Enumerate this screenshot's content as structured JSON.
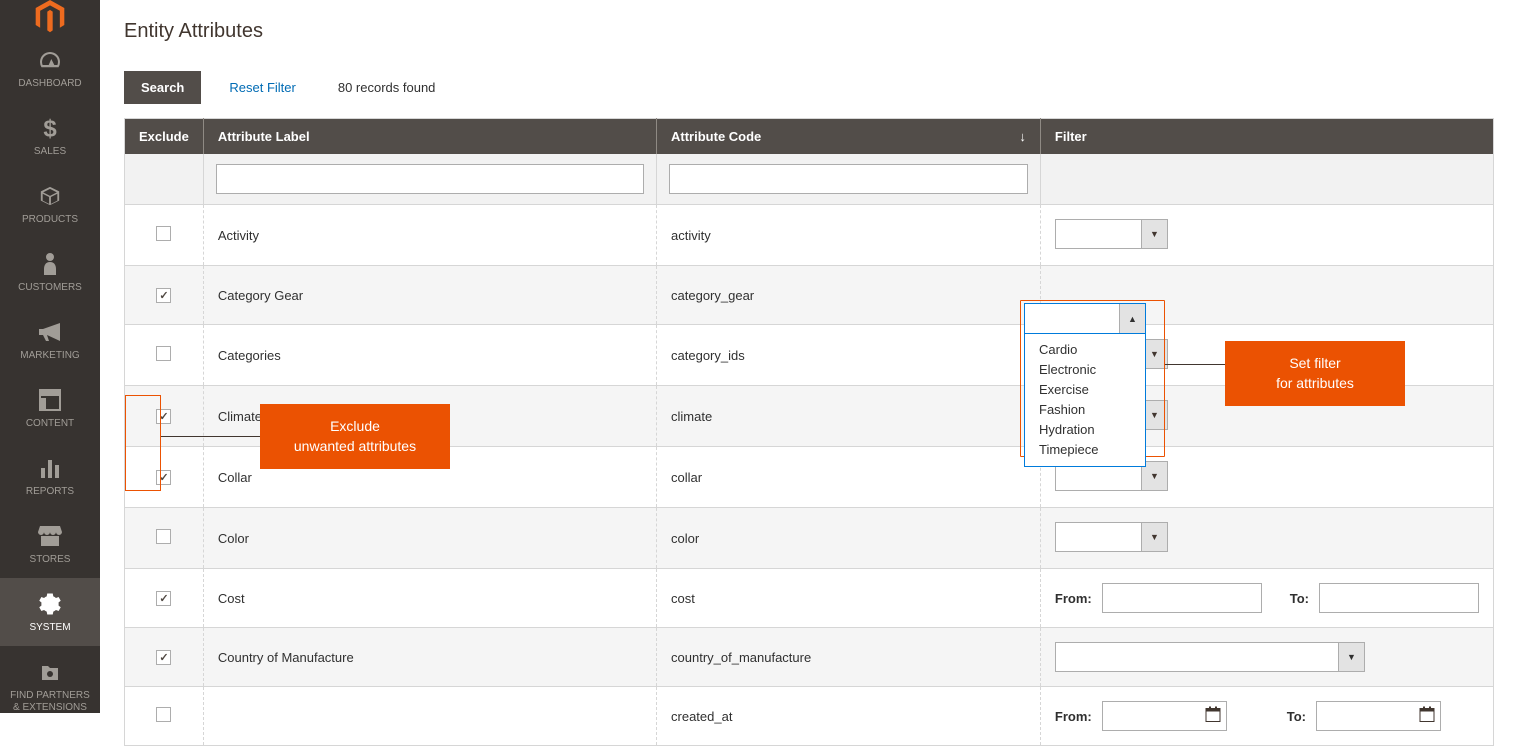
{
  "page": {
    "title": "Entity Attributes"
  },
  "toolbar": {
    "search_label": "Search",
    "reset_label": "Reset Filter",
    "records_text": "80 records found"
  },
  "sidebar": {
    "items": [
      {
        "label": "DASHBOARD"
      },
      {
        "label": "SALES"
      },
      {
        "label": "PRODUCTS"
      },
      {
        "label": "CUSTOMERS"
      },
      {
        "label": "MARKETING"
      },
      {
        "label": "CONTENT"
      },
      {
        "label": "REPORTS"
      },
      {
        "label": "STORES"
      },
      {
        "label": "SYSTEM"
      },
      {
        "label": "FIND PARTNERS\n& EXTENSIONS"
      }
    ]
  },
  "table": {
    "headers": {
      "exclude": "Exclude",
      "label": "Attribute Label",
      "code": "Attribute Code",
      "filter": "Filter"
    },
    "sort_arrow": "↓",
    "range": {
      "from": "From:",
      "to": "To:"
    },
    "rows": [
      {
        "checked": false,
        "label": "Activity",
        "code": "activity",
        "filter_type": "dd"
      },
      {
        "checked": true,
        "label": "Category Gear",
        "code": "category_gear",
        "filter_type": "dd_open"
      },
      {
        "checked": false,
        "label": "Categories",
        "code": "category_ids",
        "filter_type": "dd"
      },
      {
        "checked": true,
        "label": "Climate",
        "code": "climate",
        "filter_type": "dd"
      },
      {
        "checked": true,
        "label": "Collar",
        "code": "collar",
        "filter_type": "dd"
      },
      {
        "checked": false,
        "label": "Color",
        "code": "color",
        "filter_type": "dd"
      },
      {
        "checked": true,
        "label": "Cost",
        "code": "cost",
        "filter_type": "range"
      },
      {
        "checked": true,
        "label": "Country of Manufacture",
        "code": "country_of_manufacture",
        "filter_type": "dd_wide"
      },
      {
        "checked": false,
        "label": "",
        "code": "created_at",
        "filter_type": "date_range"
      }
    ]
  },
  "dropdown_open": {
    "options": [
      "Cardio",
      "Electronic",
      "Exercise",
      "Fashion",
      "Hydration",
      "Timepiece"
    ]
  },
  "callouts": {
    "exclude": "Exclude\nunwanted attributes",
    "filter": "Set filter\nfor attributes"
  }
}
